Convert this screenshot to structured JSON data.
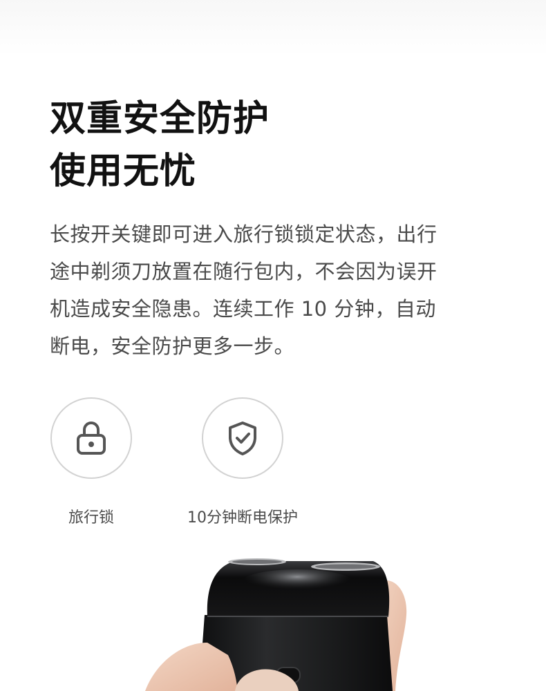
{
  "headline": {
    "line1": "双重安全防护",
    "line2": "使用无忧"
  },
  "description": {
    "lines": [
      "长按开关键即可进入旅行锁锁定状态，出行",
      "途中剃须刀放置在随行包内，不会因为误开",
      "机造成安全隐患。连续工作 10 分钟，自动",
      "断电，安全防护更多一步。"
    ]
  },
  "features": [
    {
      "label": "旅行锁",
      "icon": "padlock-icon"
    },
    {
      "label": "10分钟断电保护",
      "icon": "shield-check-icon"
    }
  ],
  "colors": {
    "headline": "#111111",
    "body_text": "#4a4a4a",
    "circle_border": "#d2d2d2",
    "icon_stroke": "#555555",
    "shaver_body": "#1b1c1e"
  }
}
